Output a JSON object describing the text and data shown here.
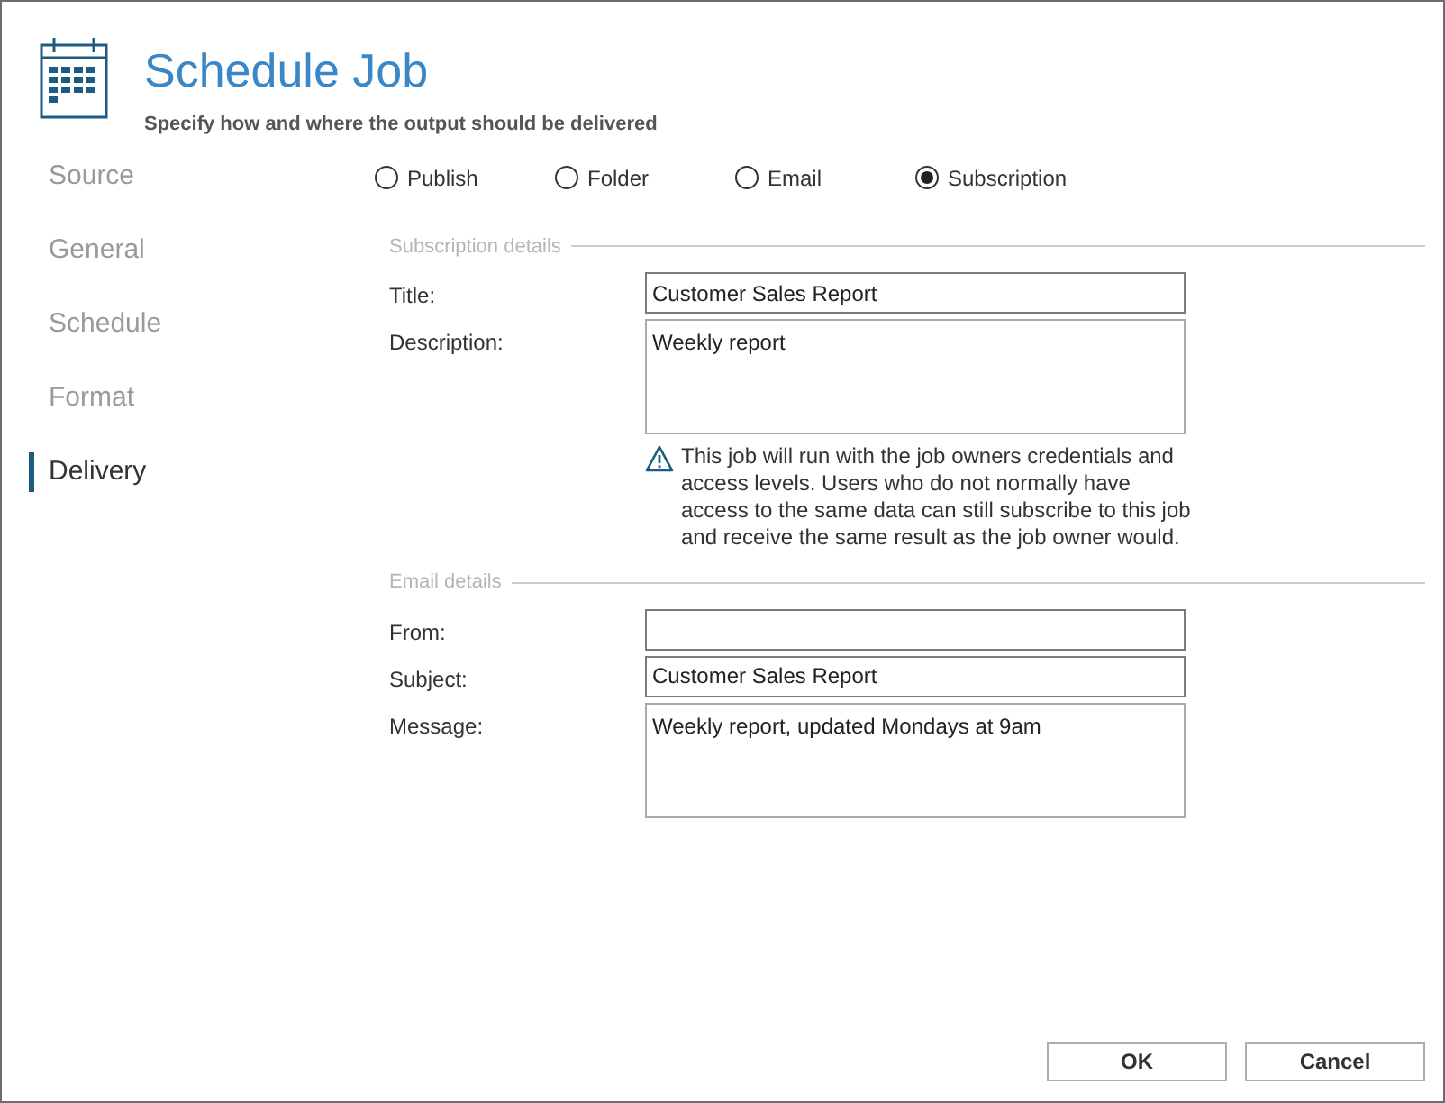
{
  "header": {
    "title": "Schedule Job",
    "subtitle": "Specify how and where the output should be delivered"
  },
  "sidebar": {
    "items": [
      {
        "label": "Source",
        "selected": false
      },
      {
        "label": "General",
        "selected": false
      },
      {
        "label": "Schedule",
        "selected": false
      },
      {
        "label": "Format",
        "selected": false
      },
      {
        "label": "Delivery",
        "selected": true
      }
    ]
  },
  "delivery_options": [
    {
      "label": "Publish",
      "selected": false
    },
    {
      "label": "Folder",
      "selected": false
    },
    {
      "label": "Email",
      "selected": false
    },
    {
      "label": "Subscription",
      "selected": true
    }
  ],
  "sections": [
    {
      "heading": "Subscription details",
      "fields": [
        {
          "label": "Title:",
          "kind": "text",
          "value": "Customer Sales Report"
        },
        {
          "label": "Description:",
          "kind": "textarea",
          "value": "Weekly report"
        }
      ],
      "note": "This job will run with the job owners credentials and access levels. Users who do not normally have access to the same data can still subscribe to this job and receive the same result as the job owner would."
    },
    {
      "heading": "Email details",
      "fields": [
        {
          "label": "From:",
          "kind": "text"
        },
        {
          "label": "Subject:",
          "kind": "text",
          "value": "Customer Sales Report"
        },
        {
          "label": "Message:",
          "kind": "textarea",
          "value": "Weekly report, updated Mondays at 9am"
        }
      ]
    }
  ],
  "buttons": [
    "OK",
    "Cancel"
  ]
}
